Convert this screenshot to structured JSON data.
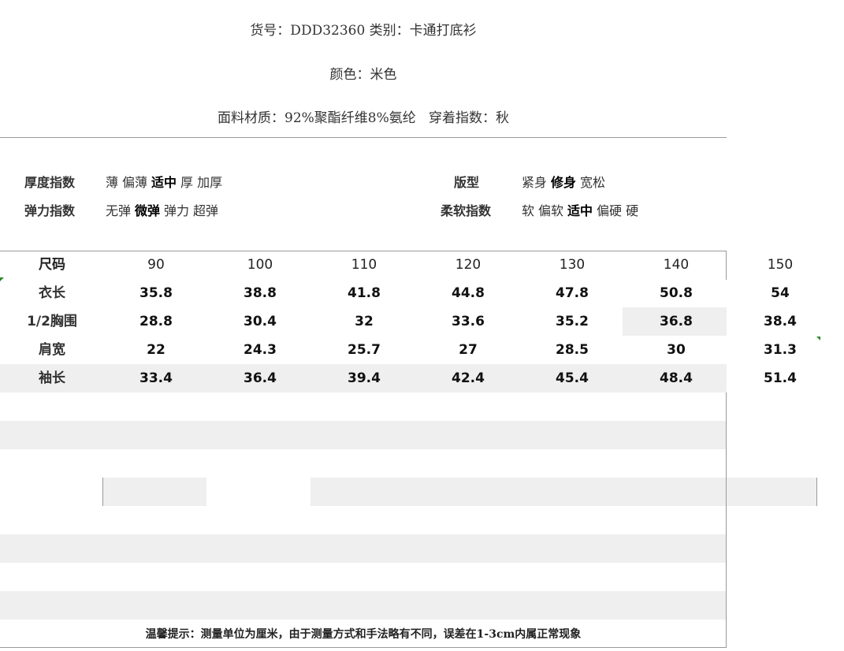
{
  "header": {
    "line1": "货号：DDD32360 类别：卡通打底衫",
    "line2": "颜色：米色",
    "line3": "面料材质：92%聚酯纤维8%氨纶   穿着指数：秋"
  },
  "indices": {
    "thickness": {
      "label": "厚度指数",
      "options": [
        "薄",
        "偏薄",
        "适中",
        "厚",
        "加厚"
      ],
      "selected": "适中"
    },
    "elasticity": {
      "label": "弹力指数",
      "options": [
        "无弹",
        "微弹",
        "弹力",
        "超弹"
      ],
      "selected": "微弹"
    },
    "fit": {
      "label": "版型",
      "options": [
        "紧身",
        "修身",
        "宽松"
      ],
      "selected": "修身"
    },
    "softness": {
      "label": "柔软指数",
      "options": [
        "软",
        "偏软",
        "适中",
        "偏硬",
        "硬"
      ],
      "selected": "适中"
    }
  },
  "size_table": {
    "columns": [
      "尺码",
      "90",
      "100",
      "110",
      "120",
      "130",
      "140",
      "150"
    ],
    "rows": [
      {
        "label": "衣长",
        "values": [
          "35.8",
          "38.8",
          "41.8",
          "44.8",
          "47.8",
          "50.8",
          "54"
        ]
      },
      {
        "label": "1/2胸围",
        "values": [
          "28.8",
          "30.4",
          "32",
          "33.6",
          "35.2",
          "36.8",
          "38.4"
        ]
      },
      {
        "label": "肩宽",
        "values": [
          "22",
          "24.3",
          "25.7",
          "27",
          "28.5",
          "30",
          "31.3"
        ]
      },
      {
        "label": "袖长",
        "values": [
          "33.4",
          "36.4",
          "39.4",
          "42.4",
          "45.4",
          "48.4",
          "51.4"
        ]
      }
    ]
  },
  "footer": {
    "note": "温馨提示：测量单位为厘米，由于测量方式和手法略有不同，误差在1-3cm内属正常现象"
  },
  "colors": {
    "stripe": "#efefef",
    "rule": "#9a9a9a",
    "mark": "#2a8a2a"
  }
}
